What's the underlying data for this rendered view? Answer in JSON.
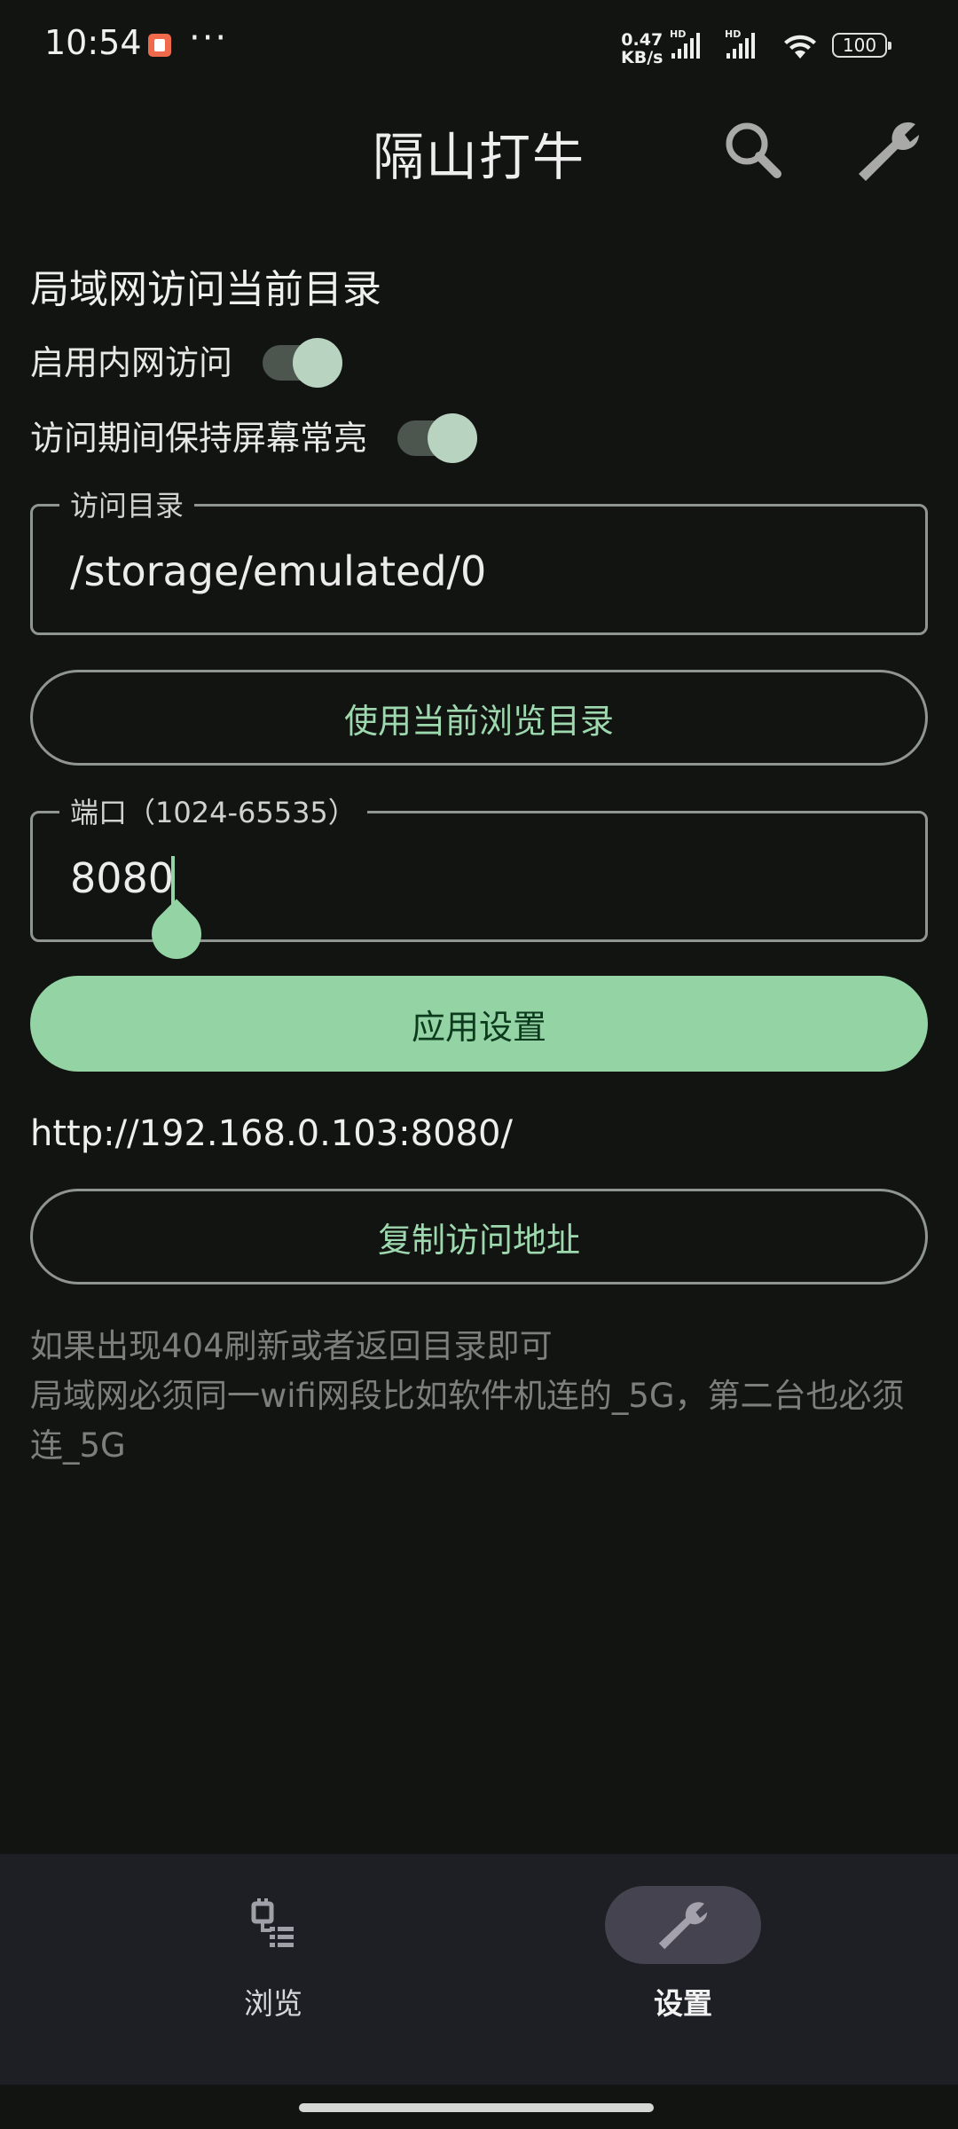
{
  "status_bar": {
    "time": "10:54",
    "dots": "···",
    "speed_top": "0.47",
    "speed_bottom": "KB/s",
    "battery": "100",
    "icons": [
      "hd-signal-icon",
      "hd-signal-icon",
      "wifi-icon",
      "battery-icon"
    ]
  },
  "app_bar": {
    "title": "隔山打牛",
    "search_icon": "search-icon",
    "settings_icon": "wrench-icon"
  },
  "lan_section": {
    "title": "局域网访问当前目录",
    "enable_lan_label": "启用内网访问",
    "enable_lan_on": true,
    "keep_screen_on_label": "访问期间保持屏幕常亮",
    "keep_screen_on_on": true
  },
  "directory_field": {
    "label": "访问目录",
    "value": "/storage/emulated/0"
  },
  "use_current_dir_button": "使用当前浏览目录",
  "port_field": {
    "label": "端口（1024-65535）",
    "value": "8080"
  },
  "apply_button": "应用设置",
  "access_url": "http://192.168.0.103:8080/",
  "copy_url_button": "复制访问地址",
  "hint_lines": [
    "如果出现404刷新或者返回目录即可",
    "局域网必须同一wifi网段比如软件机连的_5G，第二台也必须连_5G"
  ],
  "bottom_nav": {
    "items": [
      {
        "label": "浏览",
        "icon": "browse-icon",
        "selected": false
      },
      {
        "label": "设置",
        "icon": "wrench-icon",
        "selected": true
      }
    ]
  },
  "colors": {
    "background": "#121412",
    "accent": "#93d3a4",
    "nav_background": "#1e1f24"
  }
}
